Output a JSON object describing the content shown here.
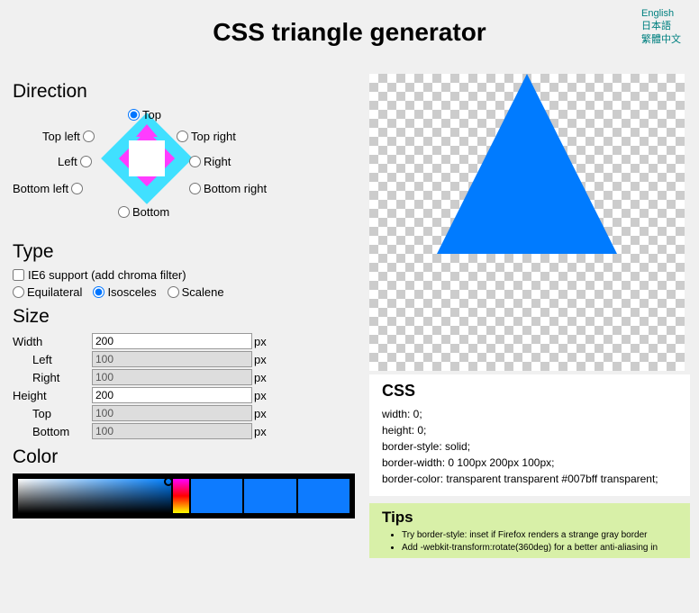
{
  "header": {
    "title": "CSS triangle generator",
    "langs": [
      "English",
      "日本語",
      "繁體中文"
    ]
  },
  "direction": {
    "heading": "Direction",
    "options": {
      "top": "Top",
      "topleft": "Top left",
      "topright": "Top right",
      "left": "Left",
      "right": "Right",
      "bottomleft": "Bottom left",
      "bottomright": "Bottom right",
      "bottom": "Bottom"
    },
    "selected": "top"
  },
  "type": {
    "heading": "Type",
    "ie6_label": "IE6 support (add chroma filter)",
    "equilateral": "Equilateral",
    "isosceles": "Isosceles",
    "scalene": "Scalene",
    "selected": "isosceles"
  },
  "size": {
    "heading": "Size",
    "width_label": "Width",
    "width_value": "200",
    "left_label": "Left",
    "left_value": "100",
    "right_label": "Right",
    "right_value": "100",
    "height_label": "Height",
    "height_value": "200",
    "top_label": "Top",
    "top_value": "100",
    "bottom_label": "Bottom",
    "bottom_value": "100",
    "unit": "px"
  },
  "color": {
    "heading": "Color",
    "value": "#007bff"
  },
  "css": {
    "heading": "CSS",
    "lines": [
      "width: 0;",
      "height: 0;",
      "border-style: solid;",
      "border-width: 0 100px 200px 100px;",
      "border-color: transparent transparent #007bff transparent;"
    ]
  },
  "tips": {
    "heading": "Tips",
    "items": [
      "Try border-style: inset if Firefox renders a strange gray border",
      "Add -webkit-transform:rotate(360deg) for a better anti-aliasing in"
    ]
  }
}
